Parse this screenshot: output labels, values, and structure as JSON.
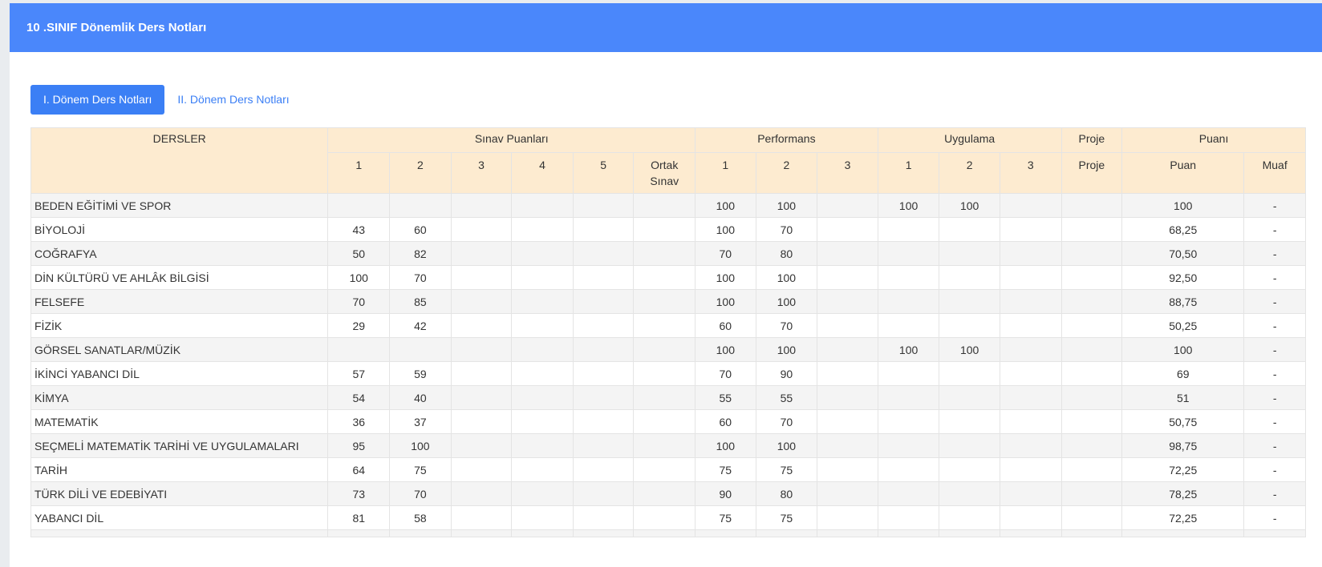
{
  "header": {
    "title": "10 .SINIF Dönemlik Ders Notları"
  },
  "tabs": [
    {
      "label": "I. Dönem Ders Notları"
    },
    {
      "label": "II. Dönem Ders Notları"
    }
  ],
  "table": {
    "group_headers": {
      "dersler": "DERSLER",
      "sinav": "Sınav Puanları",
      "performans": "Performans",
      "uygulama": "Uygulama",
      "proje": "Proje",
      "puani": "Puanı"
    },
    "sub_headers": [
      "1",
      "2",
      "3",
      "4",
      "5",
      "Ortak Sınav",
      "1",
      "2",
      "3",
      "1",
      "2",
      "3",
      "Proje",
      "Puan",
      "Muaf"
    ],
    "rows": [
      [
        "BEDEN EĞİTİMİ VE SPOR",
        "",
        "",
        "",
        "",
        "",
        "",
        "100",
        "100",
        "",
        "100",
        "100",
        "",
        "",
        "100",
        "-"
      ],
      [
        "BİYOLOJİ",
        "43",
        "60",
        "",
        "",
        "",
        "",
        "100",
        "70",
        "",
        "",
        "",
        "",
        "",
        "68,25",
        "-"
      ],
      [
        "COĞRAFYA",
        "50",
        "82",
        "",
        "",
        "",
        "",
        "70",
        "80",
        "",
        "",
        "",
        "",
        "",
        "70,50",
        "-"
      ],
      [
        "DİN KÜLTÜRÜ VE AHLÂK BİLGİSİ",
        "100",
        "70",
        "",
        "",
        "",
        "",
        "100",
        "100",
        "",
        "",
        "",
        "",
        "",
        "92,50",
        "-"
      ],
      [
        "FELSEFE",
        "70",
        "85",
        "",
        "",
        "",
        "",
        "100",
        "100",
        "",
        "",
        "",
        "",
        "",
        "88,75",
        "-"
      ],
      [
        "FİZİK",
        "29",
        "42",
        "",
        "",
        "",
        "",
        "60",
        "70",
        "",
        "",
        "",
        "",
        "",
        "50,25",
        "-"
      ],
      [
        "GÖRSEL SANATLAR/MÜZİK",
        "",
        "",
        "",
        "",
        "",
        "",
        "100",
        "100",
        "",
        "100",
        "100",
        "",
        "",
        "100",
        "-"
      ],
      [
        "İKİNCİ YABANCI DİL",
        "57",
        "59",
        "",
        "",
        "",
        "",
        "70",
        "90",
        "",
        "",
        "",
        "",
        "",
        "69",
        "-"
      ],
      [
        "KİMYA",
        "54",
        "40",
        "",
        "",
        "",
        "",
        "55",
        "55",
        "",
        "",
        "",
        "",
        "",
        "51",
        "-"
      ],
      [
        "MATEMATİK",
        "36",
        "37",
        "",
        "",
        "",
        "",
        "60",
        "70",
        "",
        "",
        "",
        "",
        "",
        "50,75",
        "-"
      ],
      [
        "SEÇMELİ MATEMATİK TARİHİ VE UYGULAMALARI",
        "95",
        "100",
        "",
        "",
        "",
        "",
        "100",
        "100",
        "",
        "",
        "",
        "",
        "",
        "98,75",
        "-"
      ],
      [
        "TARİH",
        "64",
        "75",
        "",
        "",
        "",
        "",
        "75",
        "75",
        "",
        "",
        "",
        "",
        "",
        "72,25",
        "-"
      ],
      [
        "TÜRK DİLİ VE EDEBİYATI",
        "73",
        "70",
        "",
        "",
        "",
        "",
        "90",
        "80",
        "",
        "",
        "",
        "",
        "",
        "78,25",
        "-"
      ],
      [
        "YABANCI DİL",
        "81",
        "58",
        "",
        "",
        "",
        "",
        "75",
        "75",
        "",
        "",
        "",
        "",
        "",
        "72,25",
        "-"
      ]
    ]
  }
}
